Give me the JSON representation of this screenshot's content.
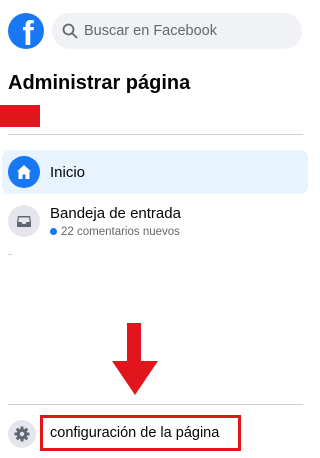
{
  "header": {
    "logo": "facebook-logo",
    "search_placeholder": "Buscar en Facebook"
  },
  "page_title": "Administrar página",
  "nav": {
    "items": [
      {
        "label": "Inicio",
        "icon": "home-icon",
        "active": true
      },
      {
        "label": "Bandeja de entrada",
        "icon": "inbox-icon",
        "subtitle": "22 comentarios nuevos"
      }
    ]
  },
  "settings": {
    "label": "configuración de la página",
    "icon": "gear-icon"
  },
  "colors": {
    "brand": "#1877f2",
    "annotation_red": "#e2151c",
    "active_bg": "#e7f3ff"
  }
}
